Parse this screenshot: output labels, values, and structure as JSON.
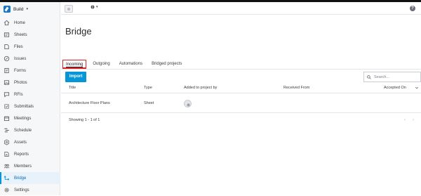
{
  "app": {
    "name": "Build",
    "top_strip_text": ""
  },
  "sidebar": {
    "items": [
      {
        "label": "Home",
        "icon": "home-icon"
      },
      {
        "label": "Sheets",
        "icon": "sheets-icon"
      },
      {
        "label": "Files",
        "icon": "files-icon"
      },
      {
        "label": "Issues",
        "icon": "issues-icon"
      },
      {
        "label": "Forms",
        "icon": "forms-icon"
      },
      {
        "label": "Photos",
        "icon": "photos-icon"
      },
      {
        "label": "RFIs",
        "icon": "rfis-icon"
      },
      {
        "label": "Submittals",
        "icon": "submittals-icon"
      },
      {
        "label": "Meetings",
        "icon": "meetings-icon"
      },
      {
        "label": "Schedule",
        "icon": "schedule-icon"
      },
      {
        "label": "Assets",
        "icon": "assets-icon"
      },
      {
        "label": "Reports",
        "icon": "reports-icon"
      },
      {
        "label": "Members",
        "icon": "members-icon"
      },
      {
        "label": "Bridge",
        "icon": "bridge-icon",
        "active": true
      },
      {
        "label": "Settings",
        "icon": "settings-icon"
      }
    ]
  },
  "page": {
    "title": "Bridge",
    "tabs": [
      {
        "label": "Incoming",
        "active": true
      },
      {
        "label": "Outgoing"
      },
      {
        "label": "Automations"
      },
      {
        "label": "Bridged projects"
      }
    ],
    "import_label": "Import",
    "search_placeholder": "Search..."
  },
  "table": {
    "columns": [
      "Title",
      "Type",
      "Added to project by",
      "Received From",
      "Accepted On"
    ],
    "rows": [
      {
        "title": "Architecture Floor Plans",
        "type": "Sheet",
        "added_by_icon": "user-avatar-icon",
        "received_from": "",
        "accepted_on": ""
      }
    ],
    "footer": "Showing 1 - 1 of 1"
  },
  "colors": {
    "accent": "#0696d7",
    "highlight_box": "#d92828",
    "sidebar_bg": "#f6f7f8"
  }
}
